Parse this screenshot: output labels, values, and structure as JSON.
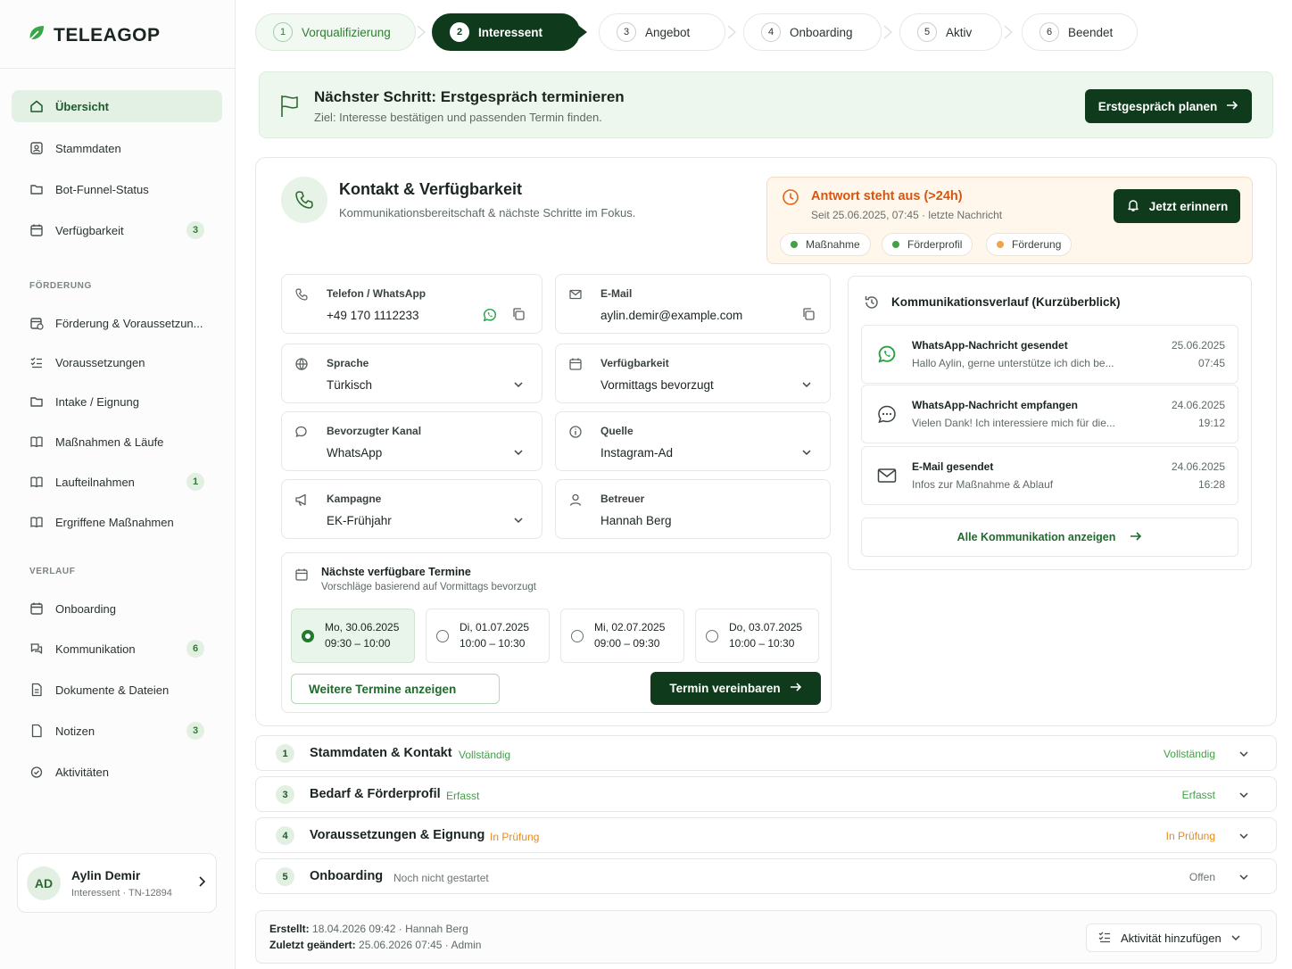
{
  "app": {
    "logo": "TELEAGOP"
  },
  "sidebar": {
    "items": [
      {
        "label": "Übersicht",
        "icon": "home-icon",
        "active": true
      },
      {
        "label": "Stammdaten",
        "icon": "id-card-icon"
      },
      {
        "label": "Bot-Funnel-Status",
        "icon": "folder-icon"
      },
      {
        "label": "Verfügbarkeit",
        "icon": "calendar-icon",
        "badge": "3"
      }
    ],
    "section_foerderung": "FÖRDERUNG",
    "foerderung_items": [
      {
        "label": "Förderung & Voraussetzun...",
        "icon": "calendar-euro-icon"
      },
      {
        "label": "Voraussetzungen",
        "icon": "checklist-icon"
      },
      {
        "label": "Intake / Eignung",
        "icon": "folder-icon"
      },
      {
        "label": "Maßnahmen & Läufe",
        "icon": "book-icon"
      },
      {
        "label": "Laufteilnahmen",
        "icon": "book-icon",
        "badge": "1"
      },
      {
        "label": "Ergriffene Maßnahmen",
        "icon": "book-icon"
      }
    ],
    "section_verlauf": "VERLAUF",
    "verlauf_items": [
      {
        "label": "Onboarding",
        "icon": "calendar-icon"
      },
      {
        "label": "Kommunikation",
        "icon": "chat-icon",
        "badge": "6"
      },
      {
        "label": "Dokumente & Dateien",
        "icon": "document-icon"
      },
      {
        "label": "Notizen",
        "icon": "note-icon",
        "badge": "3"
      },
      {
        "label": "Aktivitäten",
        "icon": "activity-icon"
      }
    ],
    "user": {
      "initials": "AD",
      "name": "Aylin Demir",
      "sub": "Interessent · TN-12894"
    }
  },
  "steps": [
    {
      "num": "1",
      "label": "Vorqualifizierung",
      "state": "done"
    },
    {
      "num": "2",
      "label": "Interessent",
      "state": "active"
    },
    {
      "num": "3",
      "label": "Angebot",
      "state": "todo"
    },
    {
      "num": "4",
      "label": "Onboarding",
      "state": "todo"
    },
    {
      "num": "5",
      "label": "Aktiv",
      "state": "todo"
    },
    {
      "num": "6",
      "label": "Beendet",
      "state": "todo"
    }
  ],
  "next_step": {
    "title": "Nächster Schritt:  Erstgespräch terminieren",
    "subtitle": "Ziel: Interesse bestätigen und passenden Termin finden.",
    "button": "Erstgespräch planen"
  },
  "contact": {
    "title": "Kontakt & Verfügbarkeit",
    "subtitle": "Kommunikationsbereitschaft & nächste Schritte im Fokus.",
    "alert": {
      "title": "Antwort steht aus (>24h)",
      "sub": "Seit 25.06.2025, 07:45  ·  letzte Nachricht",
      "button": "Jetzt erinnern",
      "chips": [
        {
          "label": "Maßnahme",
          "color": "#43a047"
        },
        {
          "label": "Förderprofil",
          "color": "#43a047"
        },
        {
          "label": "Förderung",
          "color": "#f5a14a"
        }
      ]
    },
    "fields": [
      {
        "label": "Telefon / WhatsApp",
        "value": "+49 170 1112233",
        "icon": "phone-icon"
      },
      {
        "label": "E-Mail",
        "value": "aylin.demir@example.com",
        "icon": "mail-icon"
      },
      {
        "label": "Sprache",
        "value": "Türkisch",
        "icon": "globe-icon"
      },
      {
        "label": "Verfügbarkeit",
        "value": "Vormittags bevorzugt",
        "icon": "calendar-icon"
      },
      {
        "label": "Bevorzugter Kanal",
        "value": "WhatsApp",
        "icon": "chat-icon"
      },
      {
        "label": "Quelle",
        "value": "Instagram-Ad",
        "icon": "info-icon"
      },
      {
        "label": "Kampagne",
        "value": "EK-Frühjahr",
        "icon": "megaphone-icon"
      },
      {
        "label": "Betreuer",
        "value": "Hannah Berg",
        "icon": "user-icon"
      }
    ],
    "termine": {
      "title": "Nächste verfügbare Termine",
      "subtitle": "Vorschläge basierend auf Vormittags bevorzugt",
      "slots": [
        {
          "date": "Mo, 30.06.2025",
          "time": "09:30 – 10:00",
          "selected": true
        },
        {
          "date": "Di, 01.07.2025",
          "time": "10:00 – 10:30"
        },
        {
          "date": "Mi, 02.07.2025",
          "time": "09:00 – 09:30"
        },
        {
          "date": "Do, 03.07.2025",
          "time": "10:00 – 10:30"
        }
      ],
      "more_button": "Weitere Termine anzeigen",
      "confirm_button": "Termin vereinbaren"
    },
    "comm": {
      "title": "Kommunikationsverlauf (Kurzüberblick)",
      "items": [
        {
          "title": "WhatsApp-Nachricht gesendet",
          "sub": "Hallo Aylin, gerne unterstütze ich dich be...",
          "date": "25.06.2025",
          "time": "07:45",
          "icon": "whatsapp-icon"
        },
        {
          "title": "WhatsApp-Nachricht empfangen",
          "sub": "Vielen Dank! Ich interessiere mich für die...",
          "date": "24.06.2025",
          "time": "19:12",
          "icon": "chat-bubble-icon"
        },
        {
          "title": "E-Mail gesendet",
          "sub": "Infos zur Maßnahme & Ablauf",
          "date": "24.06.2025",
          "time": "16:28",
          "icon": "mail-icon"
        }
      ],
      "all_button": "Alle Kommunikation anzeigen"
    }
  },
  "accordion": [
    {
      "num": "1",
      "title": "Stammdaten & Kontakt",
      "status": "Vollständig",
      "right": "Vollständig",
      "color": "#43a047"
    },
    {
      "num": "3",
      "title": "Bedarf & Förderprofil",
      "status": "Erfasst",
      "right": "Erfasst",
      "color": "#43a047"
    },
    {
      "num": "4",
      "title": "Voraussetzungen & Eignung",
      "status": "In Prüfung",
      "right": "In Prüfung",
      "color": "#e88a1a"
    },
    {
      "num": "5",
      "title": "Onboarding",
      "status": "Noch nicht gestartet",
      "right": "Offen",
      "color": "#6d756f"
    }
  ],
  "footer": {
    "created_label": "Erstellt:",
    "created_value": "18.04.2026 09:42  ·  Hannah Berg",
    "changed_label": "Zuletzt geändert:",
    "changed_value": "25.06.2026 07:45  ·  Admin",
    "add_button": "Aktivität hinzufügen"
  }
}
